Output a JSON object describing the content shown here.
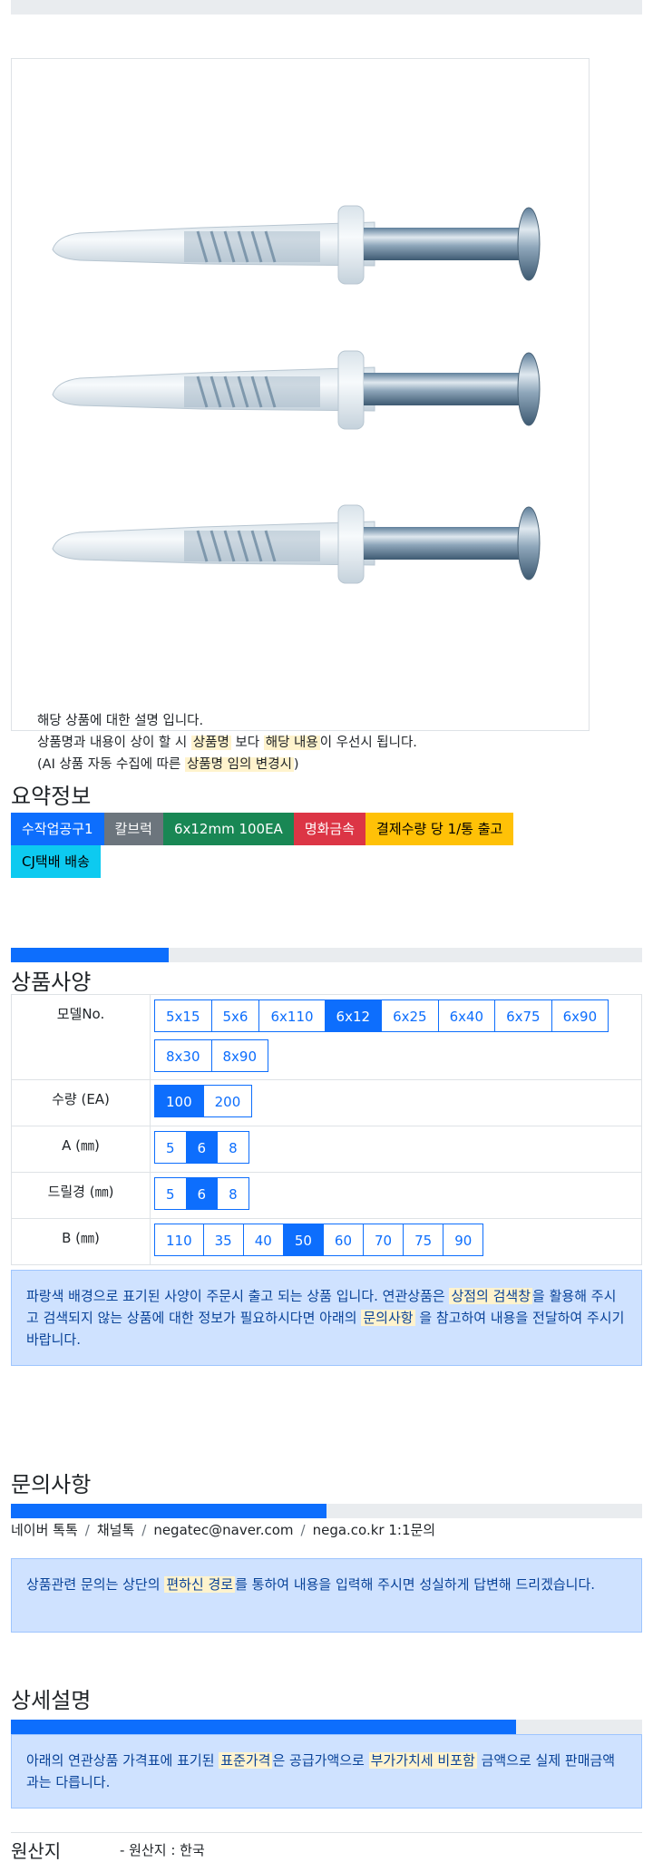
{
  "image_description": {
    "line1": "해당 상품에 대한 설명 입니다.",
    "line2_a": "상품명과 내용이 상이 할 시 ",
    "line2_hl1": "상품명",
    "line2_b": " 보다 ",
    "line2_hl2": "해당 내용",
    "line2_c": "이 우선시 됩니다.",
    "line3_a": "(AI 상품 자동 수집에 따른 ",
    "line3_hl": "상품명 임의 변경시",
    "line3_b": ")"
  },
  "summary": {
    "title": "요약정보",
    "badges": [
      {
        "label": "수작업공구1",
        "color": "#0d6efd"
      },
      {
        "label": "칼브럭",
        "color": "#6c757d"
      },
      {
        "label": "6x12mm 100EA",
        "color": "#198754"
      },
      {
        "label": "명화금속",
        "color": "#dc3545"
      },
      {
        "label": "결제수량 당 1/통 출고",
        "color": "#ffc107"
      },
      {
        "label": "CJ택배 배송",
        "color": "#0dcaf0"
      }
    ]
  },
  "spec": {
    "progress_percent": 25,
    "title": "상품사양",
    "rows": [
      {
        "label": "모델No.",
        "options": [
          "5x15",
          "5x6",
          "6x110",
          "6x12",
          "6x25",
          "6x40",
          "6x75",
          "6x90",
          "8x30",
          "8x90"
        ],
        "selected": "6x12"
      },
      {
        "label": "수량 (EA)",
        "options": [
          "100",
          "200"
        ],
        "selected": "100"
      },
      {
        "label": "A (㎜)",
        "options": [
          "5",
          "6",
          "8"
        ],
        "selected": "6"
      },
      {
        "label": "드릴경 (㎜)",
        "options": [
          "5",
          "6",
          "8"
        ],
        "selected": "6"
      },
      {
        "label": "B (㎜)",
        "options": [
          "110",
          "35",
          "40",
          "50",
          "60",
          "70",
          "75",
          "90"
        ],
        "selected": "50"
      }
    ],
    "notice_a": "파랑색 배경으로 표기된 사양이 주문시 출고 되는 상품 입니다. 연관상품은 ",
    "notice_hl1": "상점의 검색창",
    "notice_b": "을 활용해 주시고 검색되지 않는 상품에 대한 정보가 필요하시다면 아래의 ",
    "notice_hl2": "문의사항",
    "notice_c": " 을 참고하여 내용을 전달하여 주시기 바랍니다."
  },
  "inquiry": {
    "title": "문의사항",
    "progress_percent": 50,
    "contacts": [
      "네이버 톡톡",
      "채널톡",
      "negatec@naver.com",
      "nega.co.kr 1:1문의"
    ],
    "notice_a": "상품관련 문의는 상단의 ",
    "notice_hl": "편하신 경로",
    "notice_b": "를 통하여 내용을 입력해 주시면 성실하게 답변해 드리겠습니다."
  },
  "detail": {
    "title": "상세설명",
    "progress_percent": 80,
    "notice_a": "아래의 연관상품 가격표에 표기된 ",
    "notice_hl1": "표준가격",
    "notice_b": "은 공급가액으로 ",
    "notice_hl2": "부가가치세 비포함",
    "notice_c": " 금액으로 실제 판매금액과는 다릅니다."
  },
  "origin": {
    "label": "원산지",
    "value": "- 원산지 : 한국"
  }
}
